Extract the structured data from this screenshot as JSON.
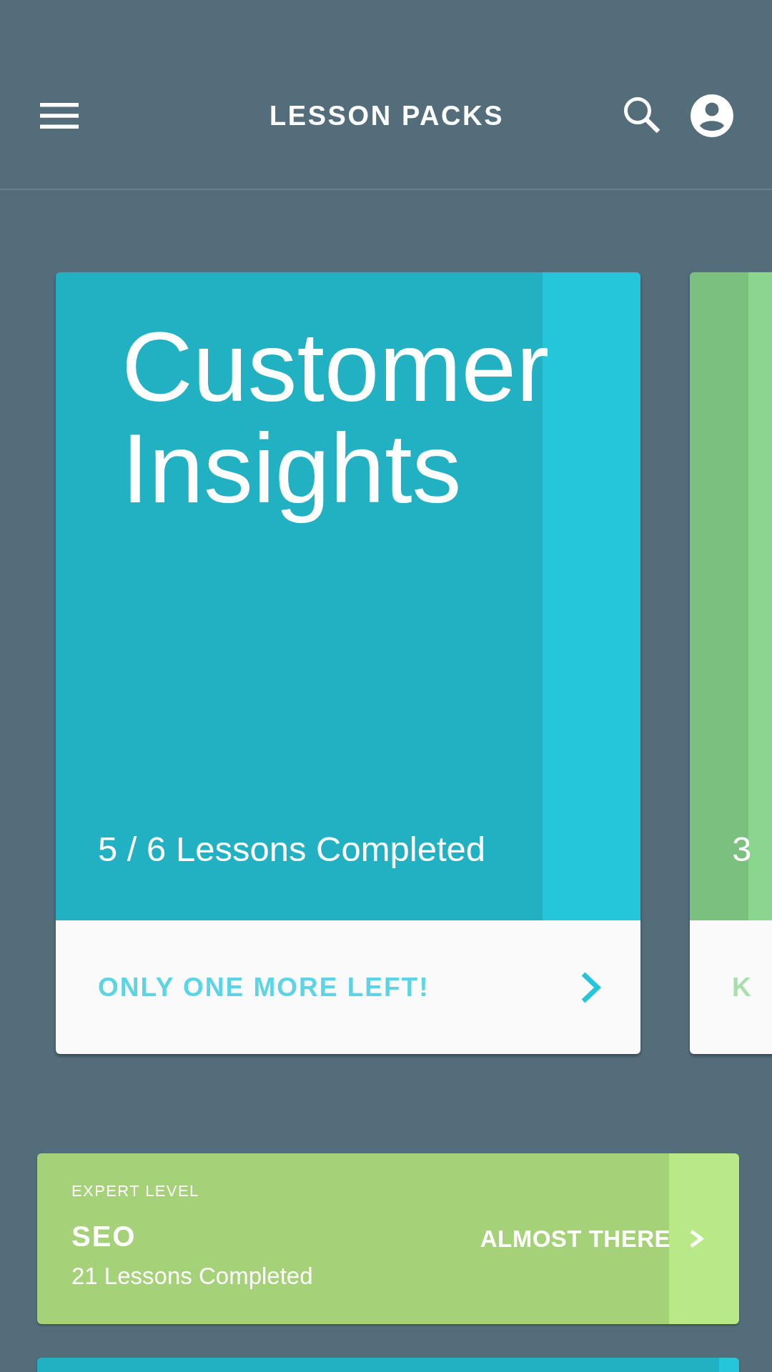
{
  "app_bar": {
    "title": "LESSON PACKS"
  },
  "featured_packs": [
    {
      "kind": "full",
      "title": "Customer Insights",
      "progress_text": "5 / 6 Lessons Completed",
      "level": 0.833,
      "color": "#26c6da",
      "action": "ONLY ONE MORE LEFT!"
    },
    {
      "kind": "peek",
      "progress_text": "3",
      "level": 0.1,
      "color": "#8bd68f",
      "action": "K"
    }
  ],
  "packs": [
    {
      "kind": "full",
      "tier": "EXPERT LEVEL",
      "title": "SEO",
      "progress_text": "21 Lessons Completed",
      "action": "ALMOST THERE",
      "level": 0.9,
      "color": "#b8e986"
    },
    {
      "kind": "peek",
      "level": 0.971,
      "color": "#26c6da"
    }
  ]
}
